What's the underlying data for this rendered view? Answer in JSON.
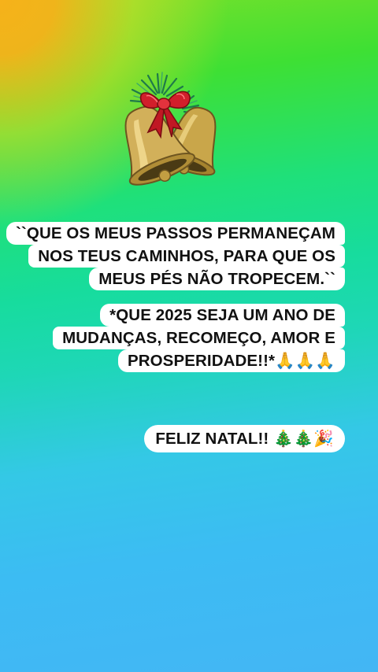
{
  "quote": {
    "lines": [
      "``QUE OS MEUS PASSOS PERMANEÇAM",
      "NOS TEUS CAMINHOS, PARA QUE OS",
      "MEUS PÉS NÃO TROPECEM.``"
    ]
  },
  "wish": {
    "lines": [
      "*QUE 2025 SEJA UM ANO DE",
      "MUDANÇAS, RECOMEÇO, AMOR E",
      "PROSPERIDADE!!*"
    ],
    "emoji": "🙏🙏🙏"
  },
  "greeting": {
    "text": "FELIZ NATAL!!",
    "emoji": "🎄🎄🎉"
  },
  "decoration": {
    "icon": "christmas-bells-icon"
  },
  "colors": {
    "top_left": "#f6b21a",
    "middle": "#1fe07a",
    "bottom": "#43b6f4",
    "bubble": "#ffffff"
  }
}
